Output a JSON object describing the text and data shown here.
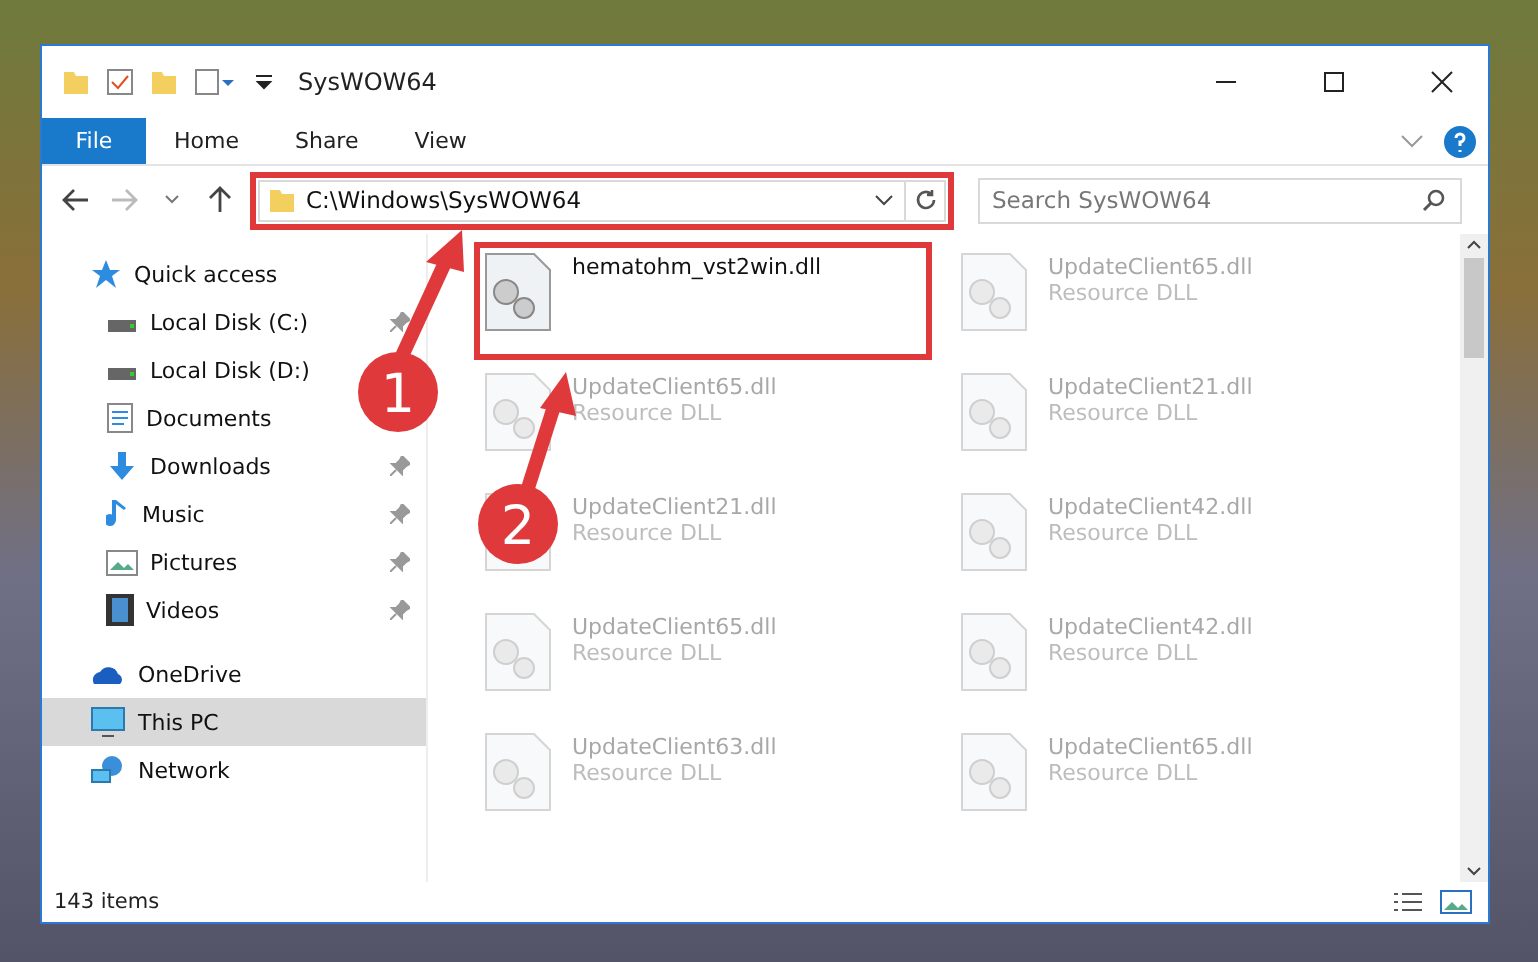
{
  "window": {
    "title": "SysWOW64"
  },
  "ribbon_tabs": [
    {
      "label": "File",
      "selected": true
    },
    {
      "label": "Home",
      "selected": false
    },
    {
      "label": "Share",
      "selected": false
    },
    {
      "label": "View",
      "selected": false
    }
  ],
  "address_bar": {
    "path": "C:\\Windows\\SysWOW64",
    "highlighted": true
  },
  "search": {
    "placeholder": "Search SysWOW64"
  },
  "sidebar": {
    "items": [
      {
        "label": "Quick access",
        "selected": false,
        "children": [
          {
            "label": "Local Disk (C:)",
            "pinned": true
          },
          {
            "label": "Local Disk (D:)",
            "pinned": false
          },
          {
            "label": "Documents",
            "pinned": false
          },
          {
            "label": "Downloads",
            "pinned": true
          },
          {
            "label": "Music",
            "pinned": true
          },
          {
            "label": "Pictures",
            "pinned": true
          },
          {
            "label": "Videos",
            "pinned": true
          }
        ]
      },
      {
        "label": "OneDrive",
        "selected": false
      },
      {
        "label": "This PC",
        "selected": true
      },
      {
        "label": "Network",
        "selected": false
      }
    ]
  },
  "files": [
    {
      "name": "hematohm_vst2win.dll",
      "faded": false,
      "highlighted": true
    },
    {
      "name": "UpdateClient65.dll",
      "type": "Resource DLL",
      "faded": true,
      "highlighted": false
    },
    {
      "name": "UpdateClient65.dll",
      "type": "Resource DLL",
      "faded": true,
      "highlighted": false
    },
    {
      "name": "UpdateClient21.dll",
      "type": "Resource DLL",
      "faded": true,
      "highlighted": false
    },
    {
      "name": "UpdateClient21.dll",
      "type": "Resource DLL",
      "faded": true,
      "highlighted": false
    },
    {
      "name": "UpdateClient42.dll",
      "type": "Resource DLL",
      "faded": true,
      "highlighted": false
    },
    {
      "name": "UpdateClient65.dll",
      "type": "Resource DLL",
      "faded": true,
      "highlighted": false
    },
    {
      "name": "UpdateClient42.dll",
      "type": "Resource DLL",
      "faded": true,
      "highlighted": false
    },
    {
      "name": "UpdateClient63.dll",
      "type": "Resource DLL",
      "faded": true,
      "highlighted": false
    },
    {
      "name": "UpdateClient65.dll",
      "type": "Resource DLL",
      "faded": true,
      "highlighted": false
    }
  ],
  "status_bar": {
    "item_count": "143 items"
  },
  "annotations": [
    {
      "number": "1"
    },
    {
      "number": "2"
    }
  ]
}
